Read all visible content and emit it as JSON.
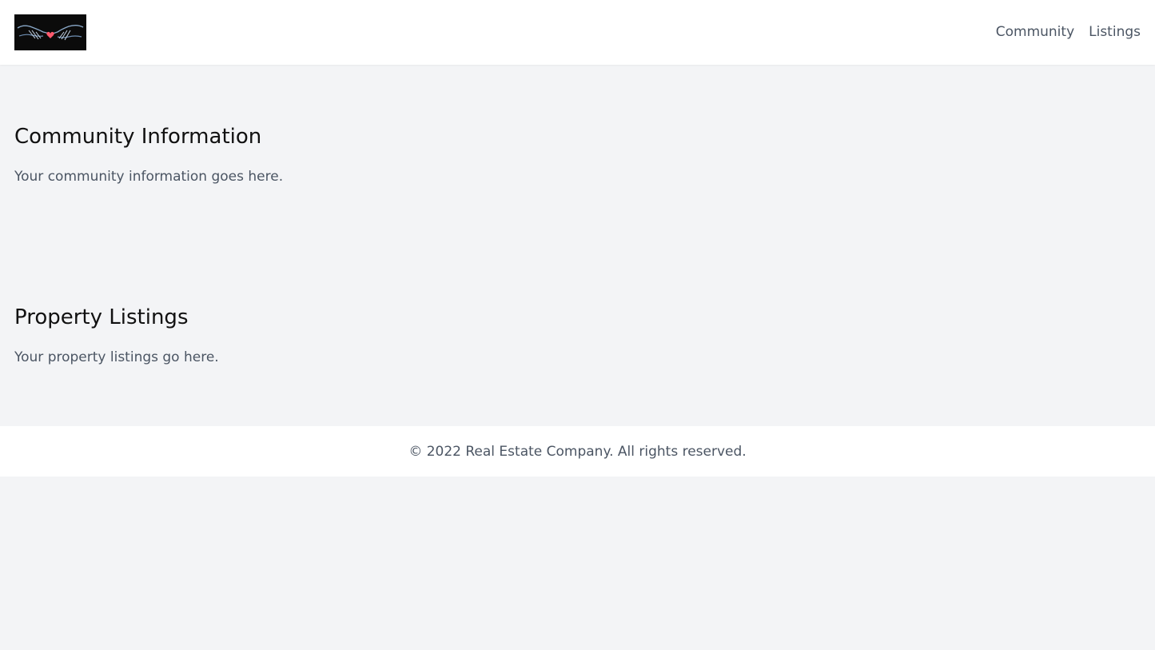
{
  "header": {
    "logo_alt": "logo",
    "nav": [
      {
        "label": "Community"
      },
      {
        "label": "Listings"
      }
    ]
  },
  "sections": [
    {
      "title": "Community Information",
      "text": "Your community information goes here."
    },
    {
      "title": "Property Listings",
      "text": "Your property listings go here."
    }
  ],
  "footer": {
    "text": "© 2022 Real Estate Company. All rights reserved."
  },
  "colors": {
    "page_bg": "#f3f4f6",
    "surface": "#ffffff",
    "heading": "#111111",
    "body_text": "#4b5563"
  }
}
